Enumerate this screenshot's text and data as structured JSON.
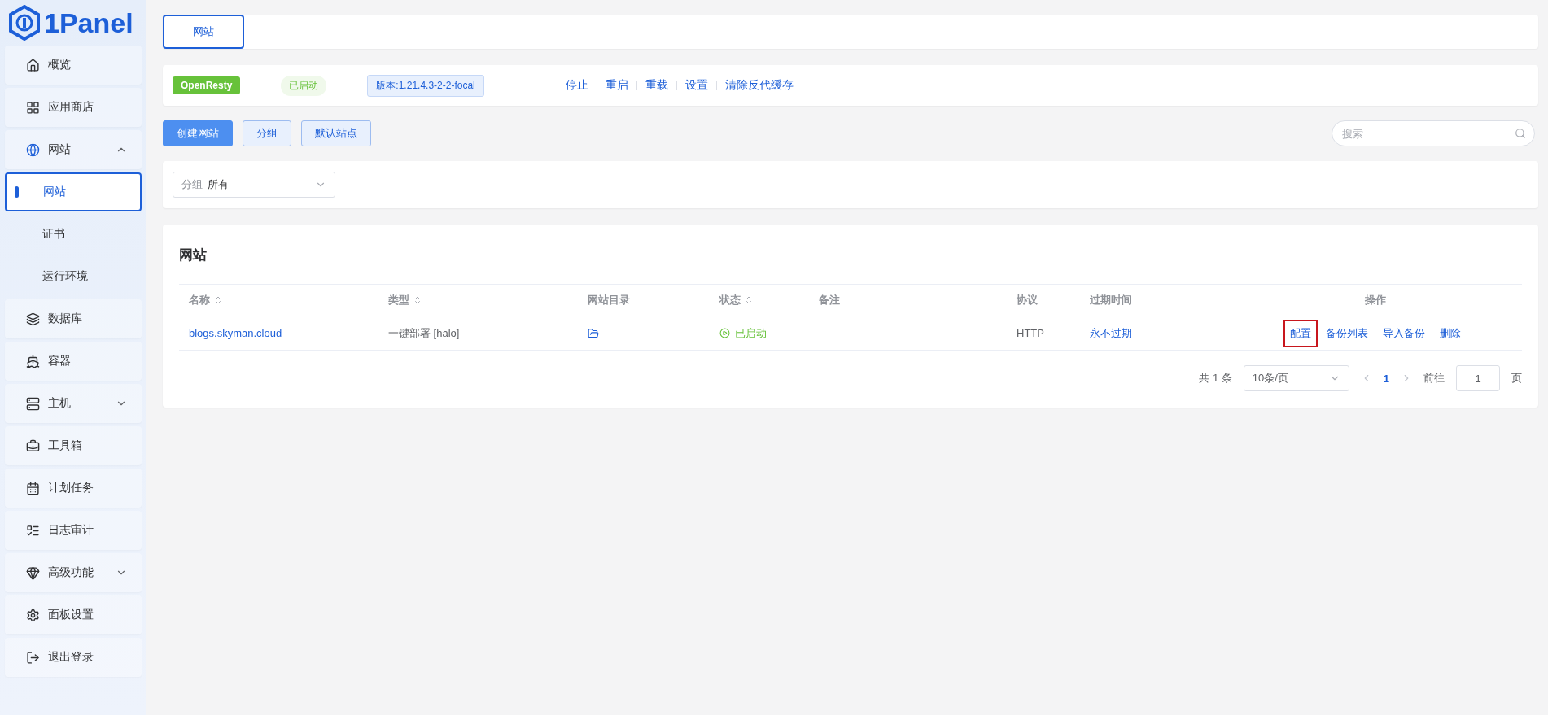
{
  "sidebar": {
    "logo": "1Panel",
    "items": [
      {
        "label": "概览",
        "selected": false
      },
      {
        "label": "应用商店",
        "selected": false
      },
      {
        "label": "网站",
        "selected": false,
        "expanded": true,
        "children": [
          {
            "label": "网站",
            "selected": true
          },
          {
            "label": "证书",
            "selected": false
          },
          {
            "label": "运行环境",
            "selected": false
          }
        ]
      },
      {
        "label": "数据库",
        "selected": false
      },
      {
        "label": "容器",
        "selected": false
      },
      {
        "label": "主机",
        "selected": false,
        "expanded": false
      },
      {
        "label": "工具箱",
        "selected": false
      },
      {
        "label": "计划任务",
        "selected": false
      },
      {
        "label": "日志审计",
        "selected": false
      },
      {
        "label": "高级功能",
        "selected": false,
        "expanded": false
      },
      {
        "label": "面板设置",
        "selected": false
      },
      {
        "label": "退出登录",
        "selected": false
      }
    ]
  },
  "tabs": [
    {
      "label": "网站",
      "selected": true
    }
  ],
  "app_bar": {
    "app": "OpenResty",
    "status": "已启动",
    "version": "版本:1.21.4.3-2-2-focal",
    "actions": [
      "停止",
      "重启",
      "重载",
      "设置",
      "清除反代缓存"
    ]
  },
  "toolbar": {
    "buttons": [
      {
        "label": "创建网站",
        "kind": "primary"
      },
      {
        "label": "分组",
        "kind": "plain"
      },
      {
        "label": "默认站点",
        "kind": "plain"
      }
    ],
    "search": {
      "placeholder": "搜索"
    }
  },
  "filter": {
    "label": "分组",
    "value": "所有"
  },
  "table": {
    "title": "网站",
    "columns": [
      {
        "label": "名称",
        "sortable": true
      },
      {
        "label": "类型",
        "sortable": true
      },
      {
        "label": "网站目录",
        "sortable": false
      },
      {
        "label": "状态",
        "sortable": true
      },
      {
        "label": "备注",
        "sortable": false
      },
      {
        "label": "协议",
        "sortable": false
      },
      {
        "label": "过期时间",
        "sortable": false
      },
      {
        "label": "操作",
        "sortable": false
      }
    ],
    "rows": [
      {
        "name": "blogs.skyman.cloud",
        "type": "一键部署 [halo]",
        "status": "已启动",
        "remark": "",
        "protocol": "HTTP",
        "expires": "永不过期",
        "actions": [
          {
            "label": "配置",
            "highlighted": true
          },
          {
            "label": "备份列表",
            "highlighted": false
          },
          {
            "label": "导入备份",
            "highlighted": false
          },
          {
            "label": "删除",
            "highlighted": false
          }
        ]
      }
    ]
  },
  "pagination": {
    "total": "共 1 条",
    "page_size": "10条/页",
    "pages": [
      {
        "label": "1",
        "selected": true
      }
    ],
    "goto_label": "前往",
    "goto_value": "1",
    "goto_suffix": "页"
  }
}
